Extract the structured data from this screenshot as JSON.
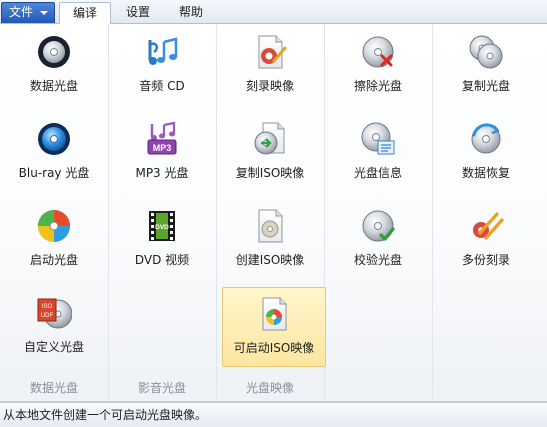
{
  "menu": {
    "file_label": "文件",
    "tabs": [
      {
        "label": "编译",
        "active": true
      },
      {
        "label": "设置",
        "active": false
      },
      {
        "label": "帮助",
        "active": false
      }
    ]
  },
  "groups": [
    {
      "label": "数据光盘"
    },
    {
      "label": "影音光盘"
    },
    {
      "label": "光盘映像"
    }
  ],
  "items": {
    "data_disc": {
      "label": "数据光盘",
      "icon": "data-disc-icon"
    },
    "bluray_disc": {
      "label": "Blu-ray 光盘",
      "icon": "bluray-disc-icon"
    },
    "boot_disc": {
      "label": "启动光盘",
      "icon": "boot-disc-icon"
    },
    "custom_disc": {
      "label": "自定义光盘",
      "icon": "iso-udf-disc-icon"
    },
    "audio_cd": {
      "label": "音频 CD",
      "icon": "music-notes-icon"
    },
    "mp3_disc": {
      "label": "MP3 光盘",
      "icon": "mp3-icon"
    },
    "dvd_video": {
      "label": "DVD 视频",
      "icon": "dvd-film-icon"
    },
    "burn_image": {
      "label": "刻录映像",
      "icon": "burn-image-icon"
    },
    "copy_iso": {
      "label": "复制ISO映像",
      "icon": "copy-iso-icon"
    },
    "create_iso": {
      "label": "创建ISO映像",
      "icon": "create-iso-icon"
    },
    "bootable_iso": {
      "label": "可启动ISO映像",
      "icon": "bootable-iso-icon",
      "selected": true
    },
    "erase_disc": {
      "label": "擦除光盘",
      "icon": "erase-disc-icon"
    },
    "disc_info": {
      "label": "光盘信息",
      "icon": "disc-info-icon"
    },
    "verify_disc": {
      "label": "校验光盘",
      "icon": "verify-disc-icon"
    },
    "copy_disc": {
      "label": "复制光盘",
      "icon": "copy-disc-icon"
    },
    "data_recovery": {
      "label": "数据恢复",
      "icon": "data-recovery-icon"
    },
    "multi_burn": {
      "label": "多份刻录",
      "icon": "multi-burn-icon"
    }
  },
  "status": {
    "text": "从本地文件创建一个可启动光盘映像。"
  },
  "colors": {
    "file_button": "#2358b6",
    "tab_border": "#aebfd6",
    "selected_fill": "#fde6a0",
    "selected_border": "#e8c874",
    "group_label": "#8a9099"
  }
}
